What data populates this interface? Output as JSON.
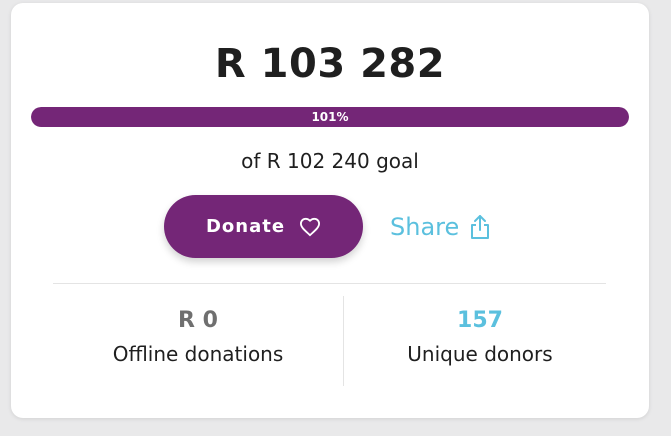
{
  "campaign": {
    "raised_amount": "R 103 282",
    "progress": {
      "label": "101%",
      "fraction": 1.01
    },
    "goal_text": "of R 102 240 goal"
  },
  "actions": {
    "donate_label": "Donate",
    "donate_icon": "heart-icon",
    "share_label": "Share",
    "share_icon": "share-icon"
  },
  "stats": {
    "offline": {
      "value": "R 0",
      "label": "Offline donations"
    },
    "donors": {
      "value": "157",
      "label": "Unique donors"
    }
  },
  "colors": {
    "brand_purple": "#742677",
    "accent_blue": "#5bc0de",
    "text_dark": "#1f1f1f",
    "text_muted": "#6f6f6f"
  }
}
